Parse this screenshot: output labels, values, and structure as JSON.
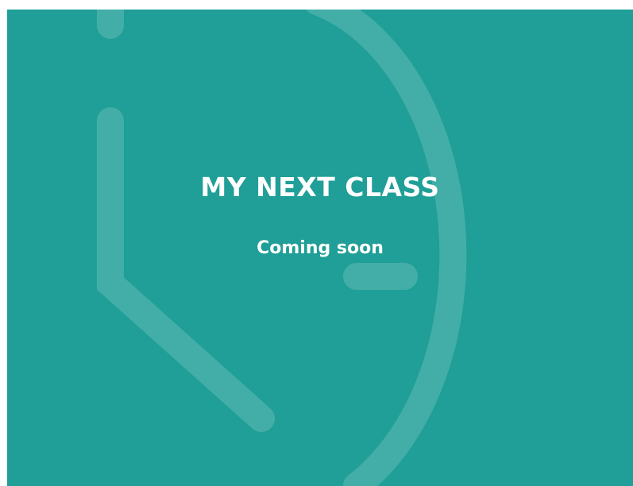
{
  "widget": {
    "title": "MY NEXT CLASS",
    "subtitle": "Coming soon",
    "background_color": "#1f9f97",
    "background_icon": "clock-icon"
  }
}
